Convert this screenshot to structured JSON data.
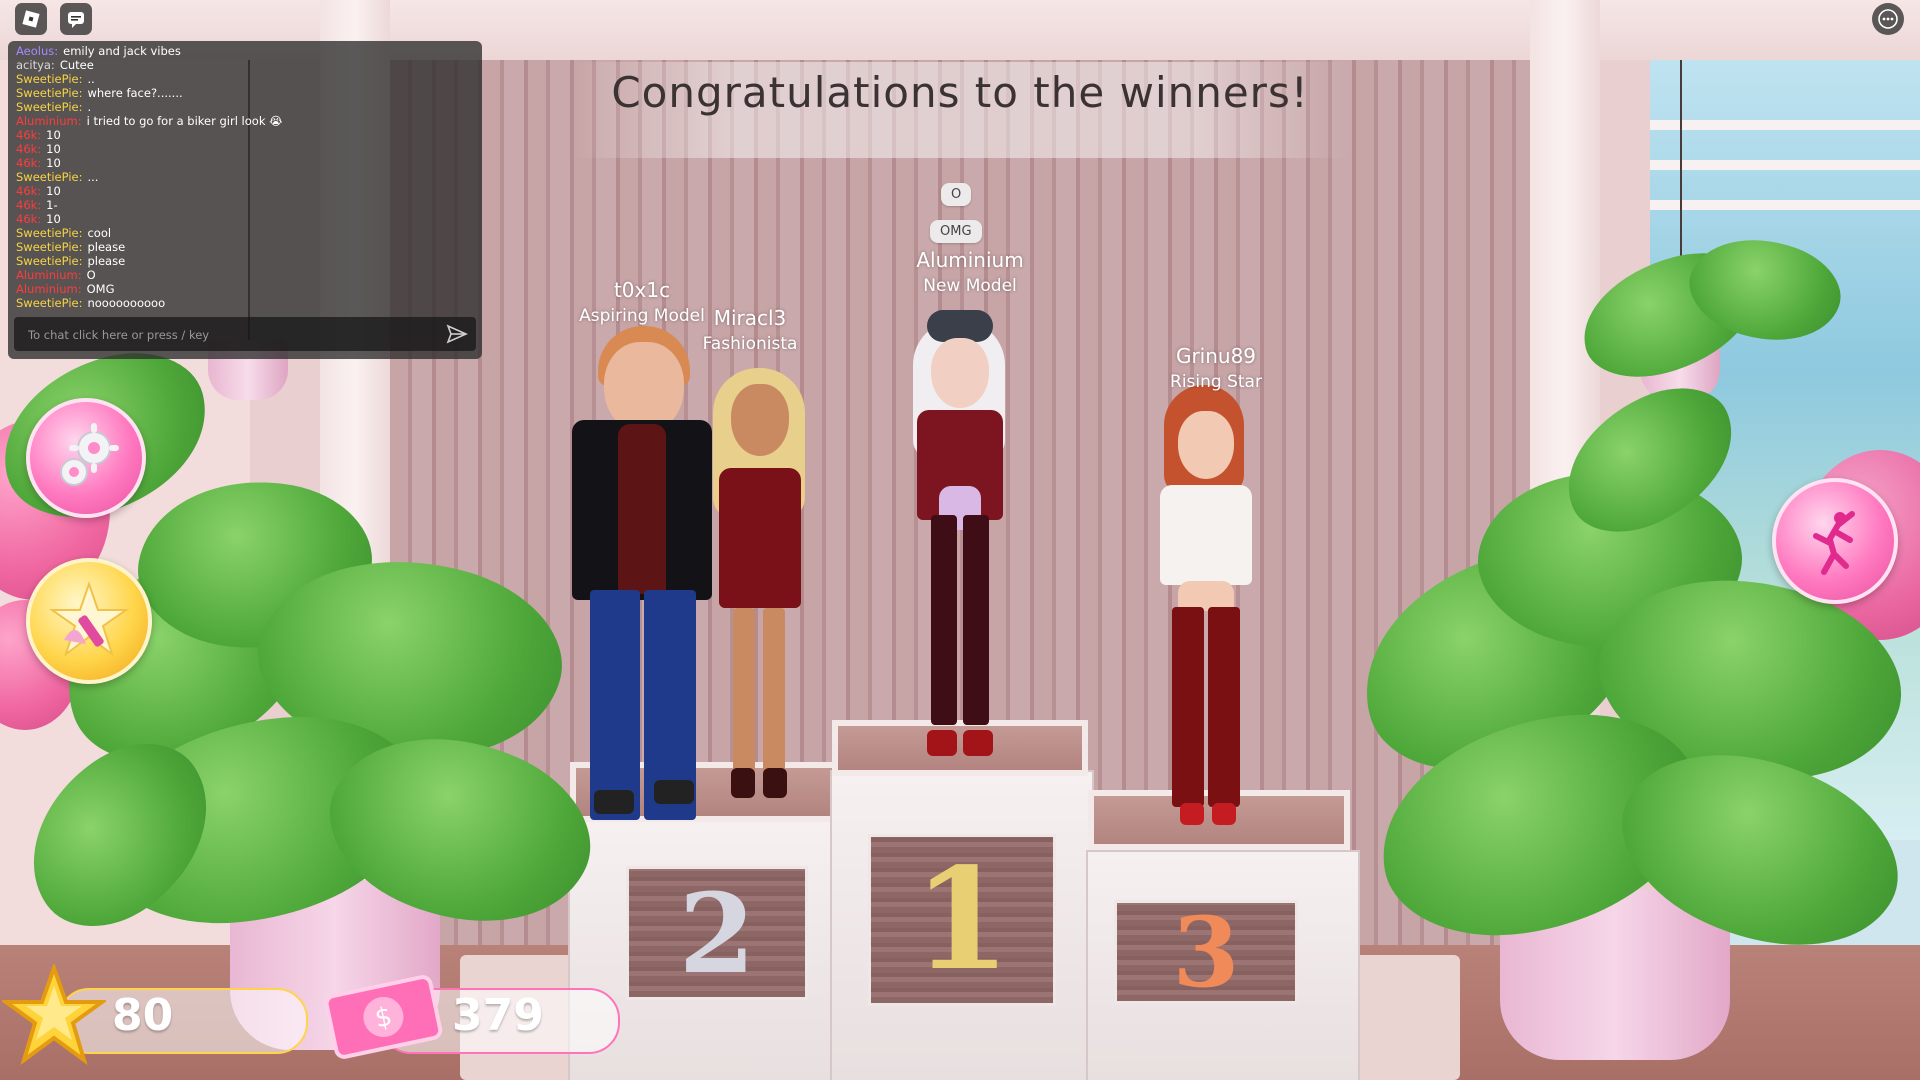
{
  "scene": {
    "title": "Congratulations to the winners!",
    "podium_numbers": [
      "2",
      "1",
      "3"
    ]
  },
  "winners": [
    {
      "name": "t0x1c",
      "title": "Aspiring Model"
    },
    {
      "name": "Miracl3",
      "title": "Fashionista"
    },
    {
      "name": "Aluminium",
      "title": "New Model",
      "bubbles": [
        "O",
        "OMG"
      ]
    },
    {
      "name": "Grinu89",
      "title": "Rising Star"
    }
  ],
  "chat": {
    "messages": [
      {
        "user": "Aeolus:",
        "text": "emily and jack vibes",
        "color": "#9d8cff"
      },
      {
        "user": "acitya:",
        "text": "Cutee",
        "color": "#d8d8d8"
      },
      {
        "user": "SweetiePie:",
        "text": "..",
        "color": "#f5d442"
      },
      {
        "user": "SweetiePie:",
        "text": "where face?.......",
        "color": "#f5d442"
      },
      {
        "user": "SweetiePie:",
        "text": ".",
        "color": "#f5d442"
      },
      {
        "user": "Aluminium:",
        "text": "i tried to go for a biker girl look 😭",
        "color": "#ff3b3b"
      },
      {
        "user": "46k:",
        "text": "10",
        "color": "#ff3b3b"
      },
      {
        "user": "46k:",
        "text": "10",
        "color": "#ff3b3b"
      },
      {
        "user": "46k:",
        "text": "10",
        "color": "#ff3b3b"
      },
      {
        "user": "SweetiePie:",
        "text": "...",
        "color": "#f5d442"
      },
      {
        "user": "46k:",
        "text": "10",
        "color": "#ff3b3b"
      },
      {
        "user": "46k:",
        "text": "1-",
        "color": "#ff3b3b"
      },
      {
        "user": "46k:",
        "text": "10",
        "color": "#ff3b3b"
      },
      {
        "user": "SweetiePie:",
        "text": "cool",
        "color": "#f5d442"
      },
      {
        "user": "SweetiePie:",
        "text": "please",
        "color": "#f5d442"
      },
      {
        "user": "SweetiePie:",
        "text": "please",
        "color": "#f5d442"
      },
      {
        "user": "Aluminium:",
        "text": "O",
        "color": "#ff3b3b"
      },
      {
        "user": "Aluminium:",
        "text": "OMG",
        "color": "#ff3b3b"
      },
      {
        "user": "SweetiePie:",
        "text": "noooooooooo",
        "color": "#f5d442"
      }
    ],
    "input_placeholder": "To chat click here or press / key"
  },
  "hud": {
    "stars": "80",
    "money": "379"
  },
  "icons": {
    "top_left": [
      "roblox-logo-icon",
      "chat-toggle-icon"
    ],
    "top_right": "more-options-icon",
    "left_buttons": [
      "settings-gears-icon",
      "dress-up-icon"
    ],
    "right_button": "pose-icon"
  },
  "colors": {
    "accent": "#ff7ac0",
    "gold": "#ffd54a"
  }
}
